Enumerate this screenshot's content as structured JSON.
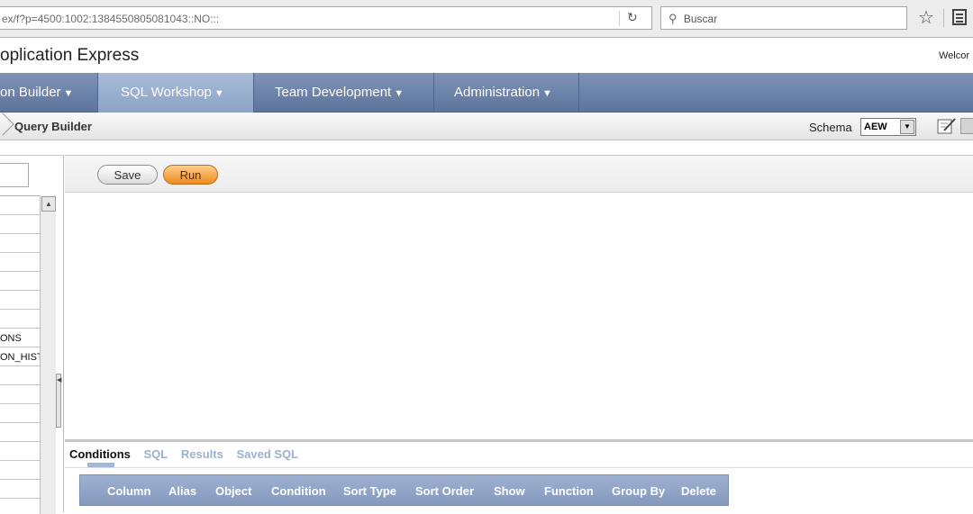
{
  "browser": {
    "url": "ex/f?p=4500:1002:1384550805081043::NO:::",
    "search_placeholder": "Buscar"
  },
  "app": {
    "title": "oplication Express",
    "welcome": "Welcor"
  },
  "nav": {
    "tabs": [
      {
        "label": "on Builder",
        "active": false
      },
      {
        "label": "SQL Workshop",
        "active": true
      },
      {
        "label": "Team Development",
        "active": false
      },
      {
        "label": "Administration",
        "active": false
      }
    ]
  },
  "breadcrumb": {
    "current": "Query Builder"
  },
  "schema": {
    "label": "Schema",
    "value": "AEW"
  },
  "left_panel": {
    "rows": [
      "",
      "",
      "",
      "",
      "",
      "",
      "",
      "ONS",
      "ON_HISTO",
      "",
      "",
      "",
      "",
      "",
      "",
      ""
    ]
  },
  "toolbar": {
    "save_label": "Save",
    "run_label": "Run"
  },
  "bottom": {
    "tabs": [
      {
        "label": "Conditions",
        "active": true
      },
      {
        "label": "SQL",
        "active": false
      },
      {
        "label": "Results",
        "active": false
      },
      {
        "label": "Saved SQL",
        "active": false
      }
    ],
    "columns": [
      "Column",
      "Alias",
      "Object",
      "Condition",
      "Sort Type",
      "Sort Order",
      "Show",
      "Function",
      "Group By",
      "Delete"
    ]
  },
  "colors": {
    "nav": "#6a80a8",
    "nav_active": "#9bb0d0",
    "run_button": "#f29a3a",
    "header_band": "#8ea1c4"
  }
}
